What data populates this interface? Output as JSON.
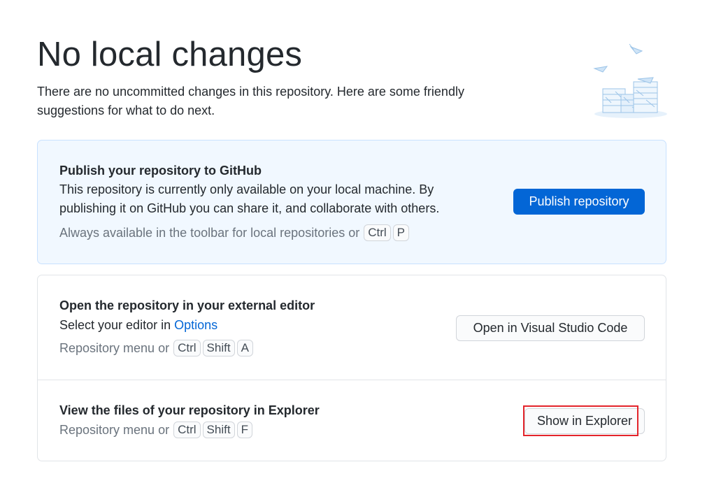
{
  "header": {
    "title": "No local changes",
    "subtitle": "There are no uncommitted changes in this repository. Here are some friendly suggestions for what to do next."
  },
  "illustration": {
    "icon": "paper-stacks-illustration"
  },
  "publish": {
    "title": "Publish your repository to GitHub",
    "description": "This repository is currently only available on your local machine. By publishing it on GitHub you can share it, and collaborate with others.",
    "hint": "Always available in the toolbar for local repositories or",
    "keys": [
      "Ctrl",
      "P"
    ],
    "button": "Publish repository"
  },
  "editor": {
    "title": "Open the repository in your external editor",
    "description_prefix": "Select your editor in",
    "description_link": "Options",
    "hint": "Repository menu or",
    "keys": [
      "Ctrl",
      "Shift",
      "A"
    ],
    "button": "Open in Visual Studio Code"
  },
  "explorer": {
    "title": "View the files of your repository in Explorer",
    "hint": "Repository menu or",
    "keys": [
      "Ctrl",
      "Shift",
      "F"
    ],
    "button": "Show in Explorer"
  },
  "colors": {
    "accent": "#0366d6",
    "publish_bg": "#f1f8ff",
    "highlight": "#e3242b"
  }
}
